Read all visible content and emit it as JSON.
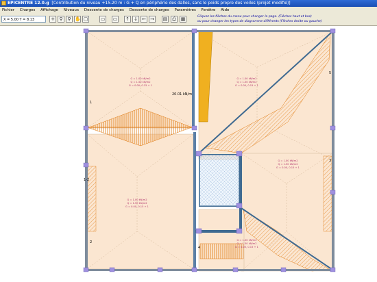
{
  "window": {
    "app_title": "EPICENTRE 12.0.g",
    "doc_title": "[Contribution du niveau +15.20 m : G + Q en périphérie des dalles, sans le poids propre des voiles (projet modifié)]"
  },
  "menu": [
    "Fichier",
    "Charges",
    "Affichage",
    "Niveaux",
    "Descente de charges",
    "Descente de charges",
    "Paramètres",
    "Fenêtre",
    "Aide"
  ],
  "toolbar": {
    "coords": "X = 5.00       Y = 8.13",
    "hint_line1": "Cliquez les flèches du menu pour changer la page. (Flèches haut et bas)",
    "hint_line2": "ou pour changer les types de diagramme différents (Flèches droite ou gauche)"
  },
  "drawing": {
    "dim_label": "20.01 kN/m",
    "wall_labels": [
      "1",
      "1-2",
      "2",
      "3",
      "4",
      "5"
    ],
    "panels": [
      {
        "id": "top-left",
        "lines": [
          "G = 1.00 kN/m2",
          "Q = 1.50 kN/m2",
          "G = 0.00, 0.15 + 1"
        ]
      },
      {
        "id": "top-right",
        "lines": [
          "G = 1.00 kN/m2",
          "Q = 1.50 kN/m2",
          "G = 0.00, 0.15 + 1"
        ]
      },
      {
        "id": "bottom-left",
        "lines": [
          "G = 1.00 kN/m2",
          "Q = 1.50 kN/m2",
          "G = 0.00, 0.15 + 1"
        ]
      },
      {
        "id": "right-mid",
        "lines": [
          "G = 1.00 kN/m2",
          "Q = 1.50 kN/m2",
          "G = 0.00, 0.15 + 1"
        ]
      },
      {
        "id": "bottom-mid",
        "lines": [
          "G = 1.00 kN/m2",
          "Q = 1.50 kN/m2",
          "G = 0.00, 0.15 + 1"
        ]
      }
    ]
  },
  "colors": {
    "slab": "#fbe6d1",
    "wall": "#5b7fa6",
    "wall_dark": "#3f6a91",
    "post": "#9f90e0",
    "hatch": "#e07a10",
    "hole": "#d9e8f8",
    "dim_fill": "#f0b020"
  }
}
